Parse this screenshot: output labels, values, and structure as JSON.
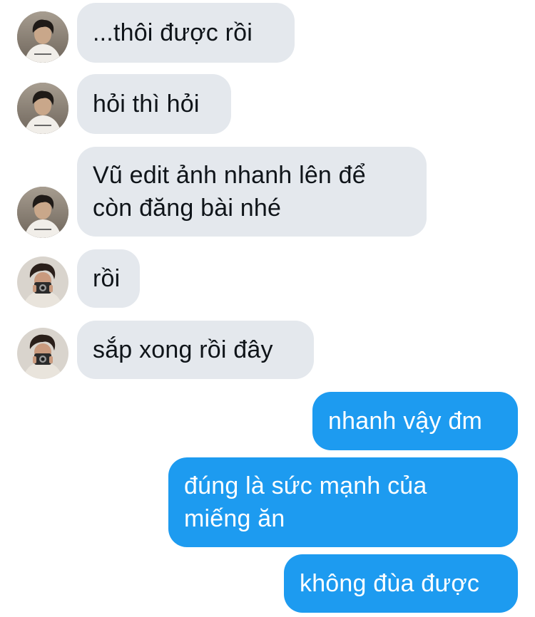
{
  "conversation": {
    "messages": [
      {
        "side": "incoming",
        "sender": "friend-a",
        "text": "...thôi được rồi"
      },
      {
        "side": "incoming",
        "sender": "friend-a",
        "text": "hỏi thì hỏi"
      },
      {
        "side": "incoming",
        "sender": "friend-a",
        "text": "Vũ edit ảnh nhanh lên để\ncòn đăng bài nhé"
      },
      {
        "side": "incoming",
        "sender": "friend-b",
        "text": "rồi"
      },
      {
        "side": "incoming",
        "sender": "friend-b",
        "text": "sắp xong rồi đây"
      },
      {
        "side": "outgoing",
        "sender": "me",
        "text": "nhanh vậy đm"
      },
      {
        "side": "outgoing",
        "sender": "me",
        "text": "đúng là sức mạnh của\nmiếng ăn"
      },
      {
        "side": "outgoing",
        "sender": "me",
        "text": "không đùa được"
      }
    ]
  },
  "colors": {
    "incoming_bubble": "#e4e8ed",
    "outgoing_bubble": "#1d9bf0",
    "incoming_text": "#0f1419",
    "outgoing_text": "#ffffff"
  },
  "icons": {
    "friend_a_avatar": "avatar-photo-white-tshirt",
    "friend_b_avatar": "avatar-photo-camera"
  }
}
